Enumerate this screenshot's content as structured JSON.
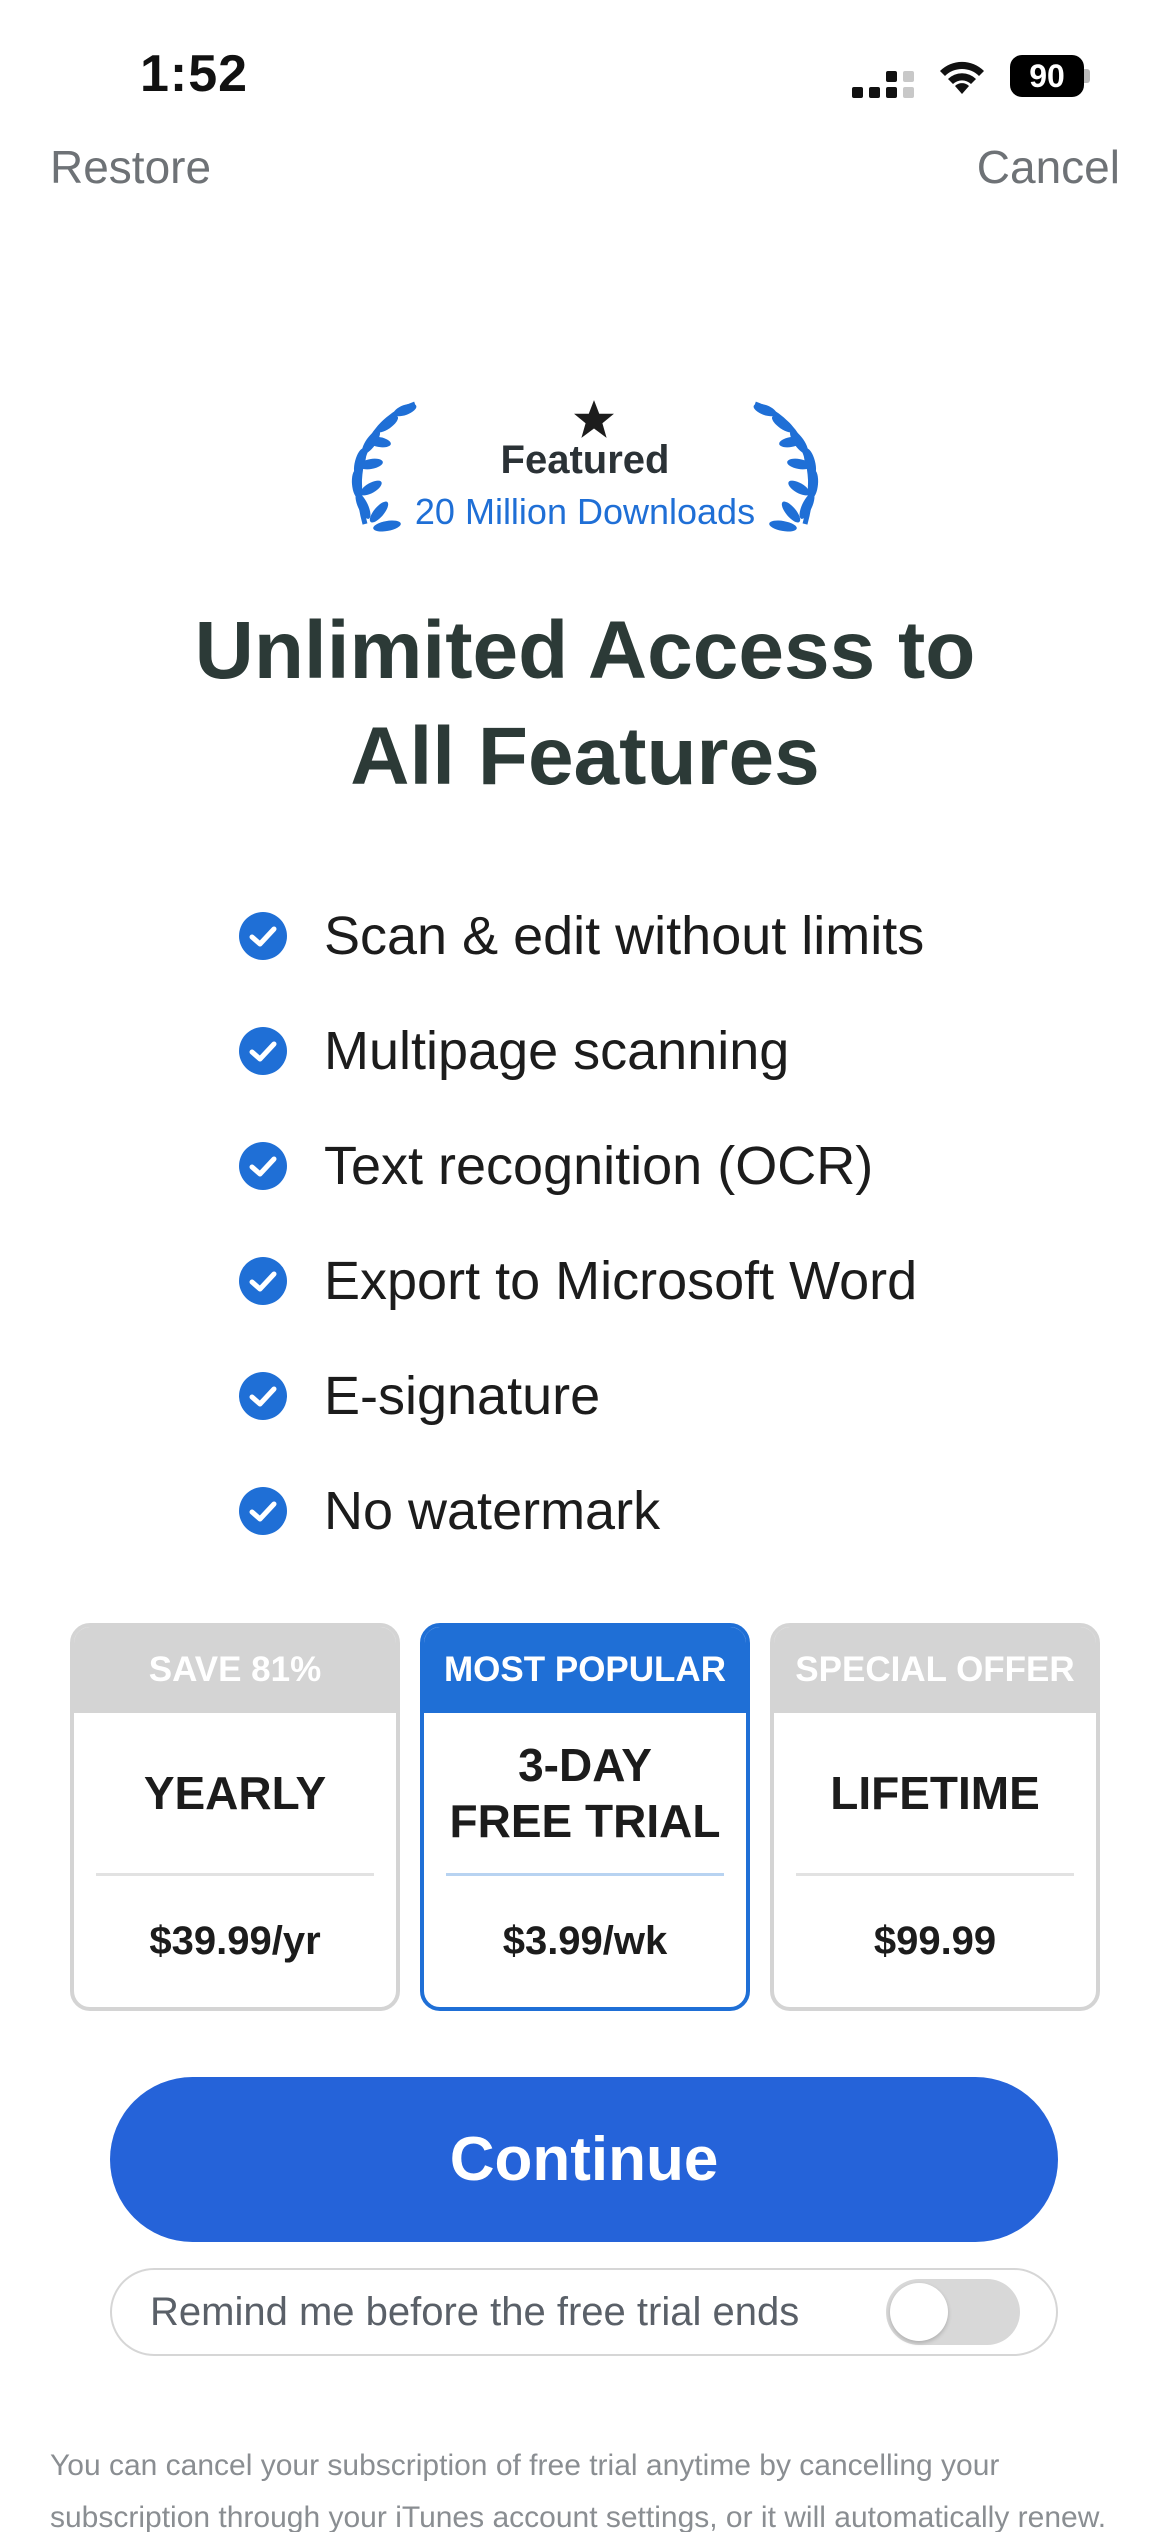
{
  "status_bar": {
    "time": "1:52",
    "battery": "90"
  },
  "nav": {
    "restore": "Restore",
    "cancel": "Cancel"
  },
  "badge": {
    "title": "Featured",
    "subtitle": "20 Million Downloads",
    "accent_color": "#1f6fd6"
  },
  "headline": {
    "line1": "Unlimited Access to",
    "line2": "All Features"
  },
  "features": [
    "Scan & edit without limits",
    "Multipage scanning",
    "Text recognition (OCR)",
    "Export to Microsoft Word",
    "E-signature",
    "No watermark"
  ],
  "plans": [
    {
      "tag": "SAVE 81%",
      "name": "YEARLY",
      "price": "$39.99/yr",
      "selected": false
    },
    {
      "tag": "MOST POPULAR",
      "name": "3-DAY\nFREE TRIAL",
      "price": "$3.99/wk",
      "selected": true
    },
    {
      "tag": "SPECIAL OFFER",
      "name": "LIFETIME",
      "price": "$99.99",
      "selected": false
    }
  ],
  "continue_label": "Continue",
  "reminder": {
    "label": "Remind me before the free trial ends",
    "enabled": false
  },
  "legal": {
    "line1": "You can cancel your subscription of free trial anytime by cancelling your",
    "line2": "subscription through your iTunes account settings, or it will automatically renew."
  },
  "colors": {
    "primary": "#2563d9",
    "selected_border": "#1f6fd6",
    "unselected_border": "#d4d4d4"
  },
  "icons": {
    "check": "check-circle-icon",
    "star": "star-icon",
    "laurel": "laurel-icon",
    "wifi": "wifi-icon",
    "signal": "signal-icon",
    "battery": "battery-icon"
  }
}
